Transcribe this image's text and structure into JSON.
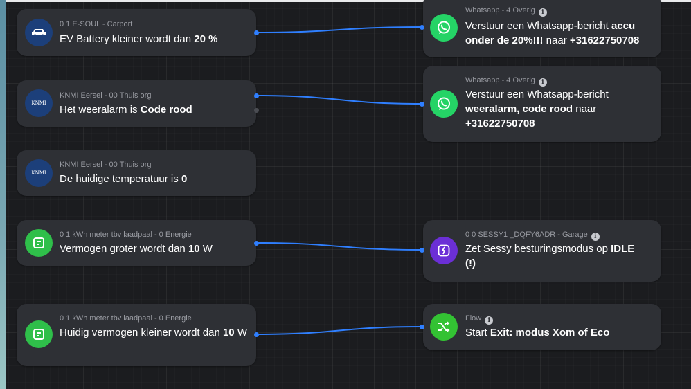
{
  "when_cards": [
    {
      "meta": "0 1 E-SOUL - Carport",
      "title_plain": "EV Battery kleiner wordt dan ",
      "title_bold": "20 %",
      "title_tail": "",
      "icon": "car-icon"
    },
    {
      "meta": "KNMI Eersel - 00 Thuis org",
      "title_plain": "Het weeralarm is ",
      "title_bold": "Code rood",
      "title_tail": "",
      "icon": "knmi-logo-icon"
    },
    {
      "meta": "KNMI Eersel - 00 Thuis org",
      "title_plain": "De huidige temperatuur is ",
      "title_bold": "0",
      "title_tail": "",
      "icon": "knmi-logo-icon"
    },
    {
      "meta": "0 1 kWh meter tbv laadpaal - 0 Energie",
      "title_plain": "Vermogen groter wordt dan ",
      "title_bold": "10",
      "title_tail": " W",
      "icon": "meter-icon"
    },
    {
      "meta": "0 1 kWh meter tbv laadpaal - 0 Energie",
      "title_plain": "Huidig vermogen kleiner wordt dan ",
      "title_bold": "10",
      "title_tail": " W",
      "icon": "meter-icon"
    }
  ],
  "then_cards": [
    {
      "meta": "Whatsapp - 4 Overig",
      "line1_plain": "Verstuur een Whatsapp-bericht ",
      "line1_bold": "accu",
      "line2_bold": "onder de 20%!!!",
      "line2_plain": " naar ",
      "line3_bold": "+31622750708"
    },
    {
      "meta": "Whatsapp - 4 Overig",
      "line1_plain": "Verstuur een Whatsapp-bericht",
      "line2_bold": "weeralarm, code rood",
      "line2_plain": " naar",
      "line3_bold": "+31622750708"
    },
    {
      "meta": "0 0 SESSY1 _DQFY6ADR - Garage",
      "line1_plain": "Zet Sessy besturingsmodus op ",
      "line1_bold": "IDLE",
      "line2_bold": "(!)"
    },
    {
      "meta": "Flow",
      "line1_plain": "Start ",
      "line1_bold": "Exit: modus Xom of Eco"
    }
  ],
  "info_glyph": "i",
  "knmi_text": "KNMI",
  "colors": {
    "whatsapp": "#25d366",
    "sessy": "#6b2fd6",
    "flow": "#33c233",
    "meter": "#2fbf4a",
    "navy": "#1c3f7a",
    "wire": "#2f7fff"
  }
}
